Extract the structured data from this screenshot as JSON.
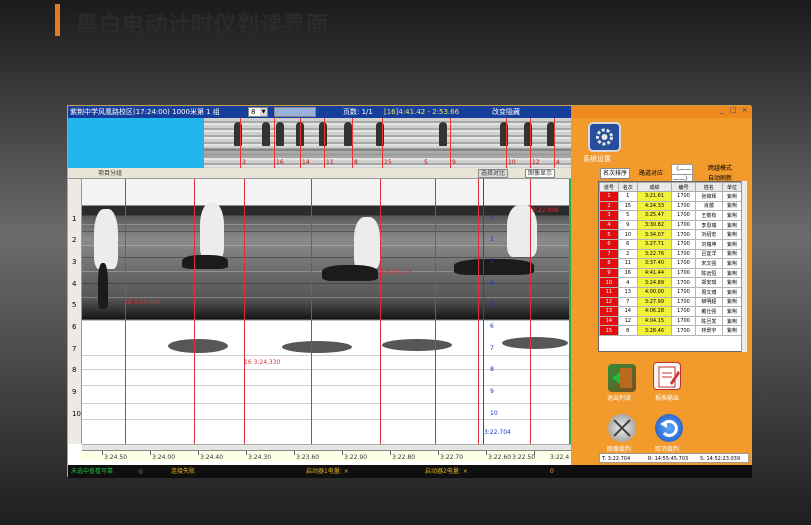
{
  "slide": {
    "title": "黑白电动计时仪判读界面"
  },
  "app": {
    "topbar": {
      "event_title": "紫荆中学风凰路校区(17:24:00) 1000米第 1 组",
      "combo_value": "8",
      "page_label": "页数: 1/1",
      "time_range": "[16]4:41.42 - 2:53.66",
      "mode_label": "改变隐藏",
      "window_controls": [
        "_",
        "□",
        "×"
      ]
    },
    "thumb_marks": [
      "3",
      "16",
      "14",
      "11",
      "8",
      "15",
      "5",
      "9",
      "10",
      "12",
      "4"
    ],
    "toolbar": {
      "left_text": "项目分组",
      "right_button_1": "选择对比",
      "right_checkbox": "图像显示"
    },
    "lanes": [
      "1",
      "2",
      "3",
      "4",
      "5",
      "6",
      "7",
      "8",
      "9",
      "10"
    ],
    "time_marks": [
      {
        "label": "18 3:24.005"
      },
      {
        "label": "16 3:24.330"
      },
      {
        "label": "9 3:22.776"
      },
      {
        "label": "3:22.006"
      }
    ],
    "blue_marks": [
      "1",
      "2",
      "3",
      "4",
      "5",
      "6",
      "7",
      "8",
      "9",
      "10"
    ],
    "blue_time": "3:22.704",
    "time_axis": [
      "3:24.50",
      "3:24.00",
      "3:24.40",
      "3:24.30",
      "3:23.60",
      "3:22.90",
      "3:22.80",
      "3:22.70",
      "3:22.60",
      "3:22.50",
      "3:22.4"
    ],
    "statusbar": {
      "left": "未选中查看可靠",
      "middle": "连接失败",
      "sensor1": "启动器1电量: ×",
      "sensor2": "启动器2电量: ×",
      "count": "0"
    },
    "right_panel": {
      "system_label": "系统设置",
      "rank_button": "名次排序",
      "link_label": "路道对应",
      "radio_1": "〈——",
      "radio_2": "——〉",
      "check_1": "跨越模式",
      "check_2": "自动刷新",
      "columns": [
        "道号",
        "名次",
        "成绩",
        "编号",
        "姓名",
        "单位"
      ],
      "rows": [
        {
          "lane": "1",
          "rank": "1",
          "score": "3:21.61",
          "num": "1700",
          "name": "张锦辉",
          "unit": "紫荆"
        },
        {
          "lane": "2",
          "rank": "15",
          "score": "4:24.33",
          "num": "1700",
          "name": "肖蕴",
          "unit": "紫荆"
        },
        {
          "lane": "3",
          "rank": "5",
          "score": "3:25.47",
          "num": "1700",
          "name": "王敬有",
          "unit": "紫荆"
        },
        {
          "lane": "4",
          "rank": "9",
          "score": "3:30.82",
          "num": "1700",
          "name": "李恩瑞",
          "unit": "紫荆"
        },
        {
          "lane": "5",
          "rank": "10",
          "score": "3:34.07",
          "num": "1700",
          "name": "刘绍宏",
          "unit": "紫荆"
        },
        {
          "lane": "6",
          "rank": "6",
          "score": "3:27.71",
          "num": "1700",
          "name": "刘瑞坤",
          "unit": "紫荆"
        },
        {
          "lane": "7",
          "rank": "2",
          "score": "3:22.76",
          "num": "1700",
          "name": "吕宜洋",
          "unit": "紫荆"
        },
        {
          "lane": "8",
          "rank": "11",
          "score": "3:37.40",
          "num": "1700",
          "name": "宋文强",
          "unit": "紫荆"
        },
        {
          "lane": "9",
          "rank": "16",
          "score": "4:41.44",
          "num": "1700",
          "name": "陈远恒",
          "unit": "紫荆"
        },
        {
          "lane": "10",
          "rank": "4",
          "score": "3:24.89",
          "num": "1700",
          "name": "郑安琪",
          "unit": "紫荆"
        },
        {
          "lane": "11",
          "rank": "13",
          "score": "4:00.00",
          "num": "1700",
          "name": "周文博",
          "unit": "紫荆"
        },
        {
          "lane": "12",
          "rank": "7",
          "score": "3:27.99",
          "num": "1700",
          "name": "柳明超",
          "unit": "紫荆"
        },
        {
          "lane": "13",
          "rank": "14",
          "score": "4:06.28",
          "num": "1700",
          "name": "戴仕强",
          "unit": "紫荆"
        },
        {
          "lane": "14",
          "rank": "12",
          "score": "4:04.15",
          "num": "1700",
          "name": "陈旦发",
          "unit": "紫荆"
        },
        {
          "lane": "15",
          "rank": "8",
          "score": "3:28.46",
          "num": "1700",
          "name": "林景宇",
          "unit": "紫荆"
        }
      ],
      "btn_exit_judge": "退出判读",
      "btn_export_report": "报表输出",
      "btn_image_judge": "图像裁判",
      "btn_cancel_judge": "取消裁判",
      "readout_t": "T: 3:22.704",
      "readout_r": "R: 14:55:45.703",
      "readout_s": "S: 14:52:23.039"
    }
  }
}
